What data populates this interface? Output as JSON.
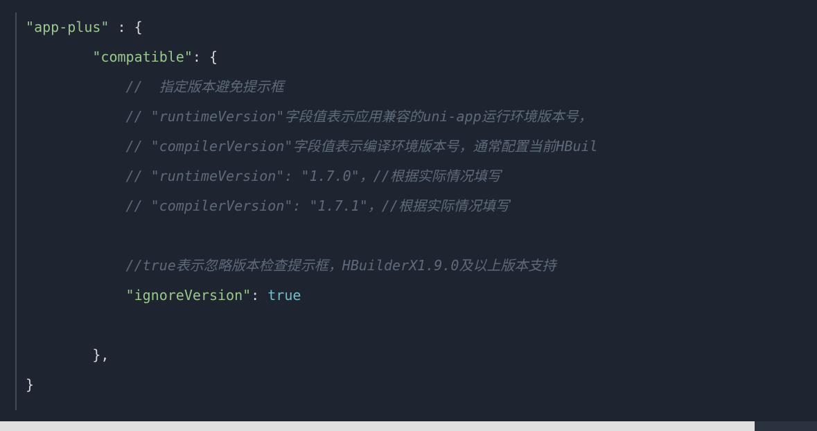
{
  "code": {
    "line1": {
      "indent": " ",
      "key": "\"app-plus\"",
      "sep": " : ",
      "brace": "{"
    },
    "line2": {
      "indent": "         ",
      "key": "\"compatible\"",
      "sep": ": ",
      "brace": "{"
    },
    "line3": {
      "indent": "             ",
      "comment": "//  指定版本避免提示框"
    },
    "line4": {
      "indent": "             ",
      "comment": "// \"runtimeVersion\"字段值表示应用兼容的uni-app运行环境版本号，"
    },
    "line5": {
      "indent": "             ",
      "comment": "// \"compilerVersion\"字段值表示编译环境版本号，通常配置当前HBuil"
    },
    "line6": {
      "indent": "             ",
      "comment": "// \"runtimeVersion\": \"1.7.0\"，//根据实际情况填写"
    },
    "line7": {
      "indent": "             ",
      "comment": "// \"compilerVersion\": \"1.7.1\"，//根据实际情况填写"
    },
    "line8": {
      "indent": "",
      "blank": " "
    },
    "line9": {
      "indent": "             ",
      "comment": "//true表示忽略版本检查提示框，HBuilderX1.9.0及以上版本支持"
    },
    "line10": {
      "indent": "             ",
      "key": "\"ignoreVersion\"",
      "sep": ": ",
      "value": "true"
    },
    "line11": {
      "indent": "",
      "blank": " "
    },
    "line12": {
      "indent": "         ",
      "brace": "}",
      "comma": ","
    },
    "line13": {
      "indent": " ",
      "brace": "}"
    }
  }
}
